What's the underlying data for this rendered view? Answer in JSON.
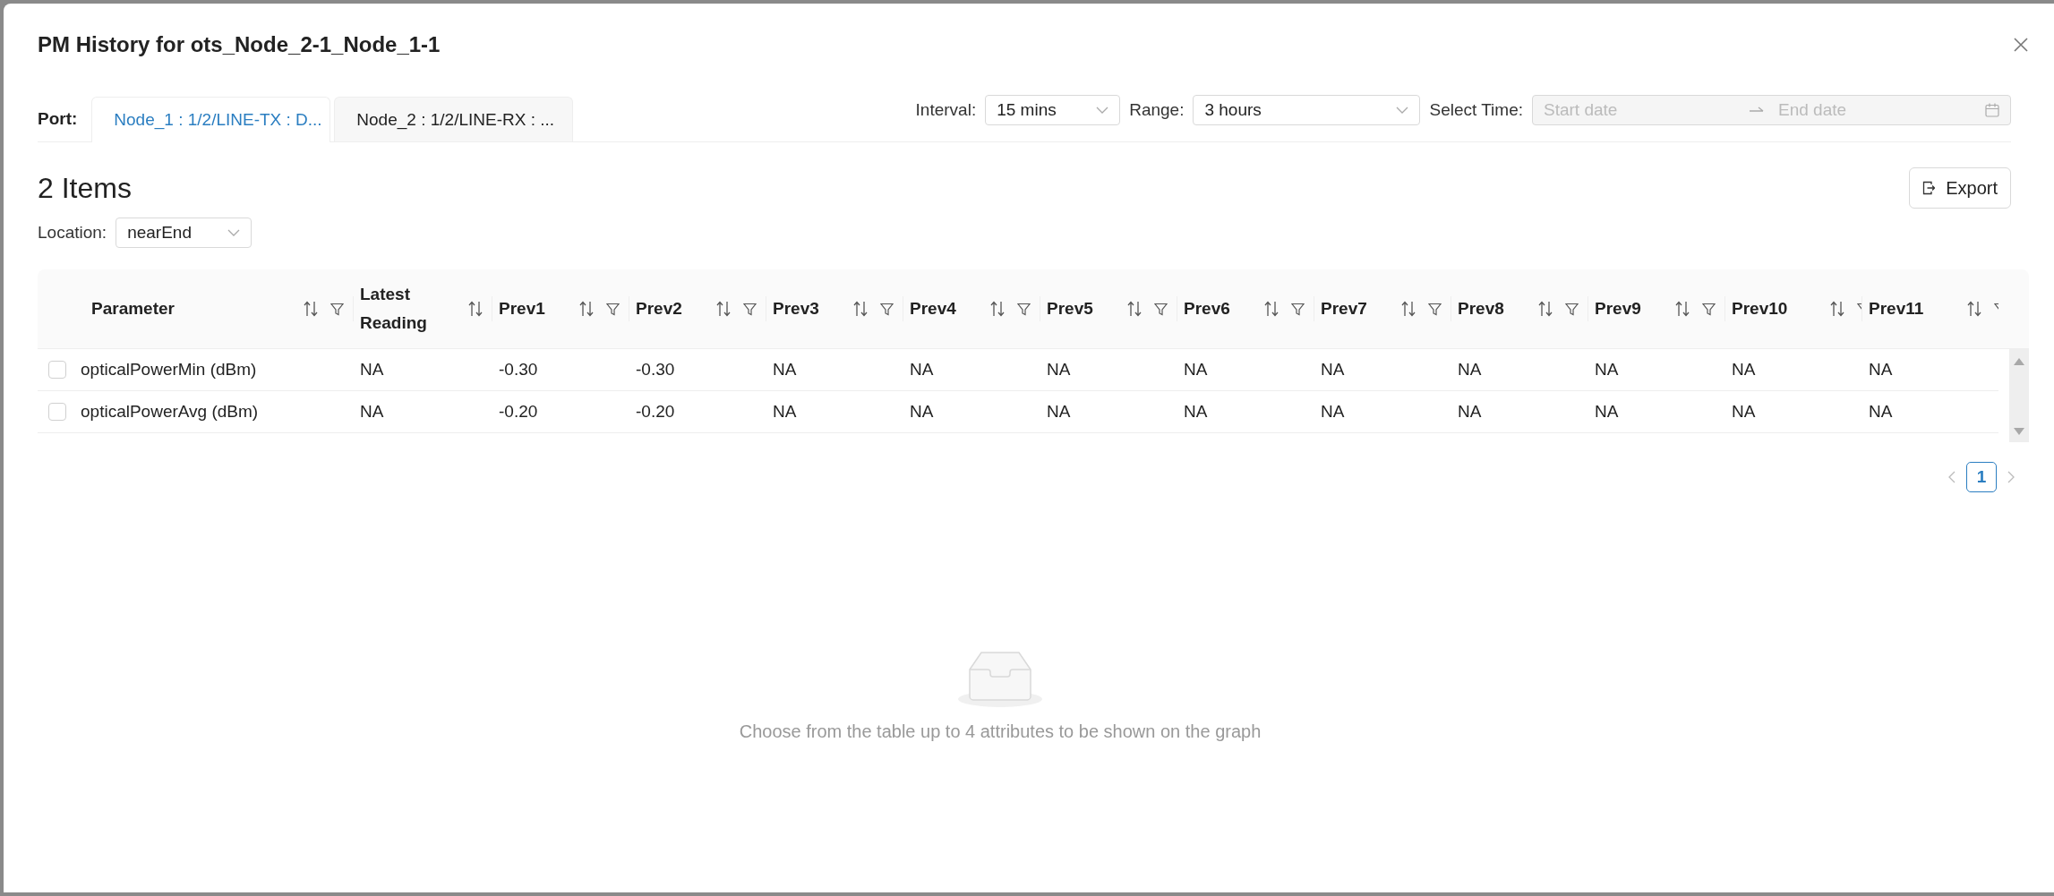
{
  "dialog": {
    "title": "PM History for ots_Node_2-1_Node_1-1"
  },
  "port": {
    "label": "Port:",
    "tabs": [
      {
        "label": "Node_1 : 1/2/LINE-TX : D...",
        "selected": true
      },
      {
        "label": "Node_2 : 1/2/LINE-RX : ...",
        "selected": false
      }
    ]
  },
  "interval": {
    "label": "Interval:",
    "value": "15 mins"
  },
  "range": {
    "label": "Range:",
    "value": "3 hours"
  },
  "select_time": {
    "label": "Select Time:",
    "start_placeholder": "Start date",
    "end_placeholder": "End date",
    "disabled": true
  },
  "items_count": "2 Items",
  "export_button": "Export",
  "location": {
    "label": "Location:",
    "value": "nearEnd"
  },
  "table": {
    "columns": [
      {
        "label": "Parameter",
        "sortable": true,
        "filterable": true
      },
      {
        "label": "Latest Reading",
        "sortable": true,
        "filterable": false
      },
      {
        "label": "Prev1",
        "sortable": true,
        "filterable": true
      },
      {
        "label": "Prev2",
        "sortable": true,
        "filterable": true
      },
      {
        "label": "Prev3",
        "sortable": true,
        "filterable": true
      },
      {
        "label": "Prev4",
        "sortable": true,
        "filterable": true
      },
      {
        "label": "Prev5",
        "sortable": true,
        "filterable": true
      },
      {
        "label": "Prev6",
        "sortable": true,
        "filterable": true
      },
      {
        "label": "Prev7",
        "sortable": true,
        "filterable": true
      },
      {
        "label": "Prev8",
        "sortable": true,
        "filterable": true
      },
      {
        "label": "Prev9",
        "sortable": true,
        "filterable": true
      },
      {
        "label": "Prev10",
        "sortable": true,
        "filterable": true
      },
      {
        "label": "Prev11",
        "sortable": true,
        "filterable": true
      }
    ],
    "rows": [
      {
        "checked": false,
        "cells": [
          "opticalPowerMin (dBm)",
          "NA",
          "-0.30",
          "-0.30",
          "NA",
          "NA",
          "NA",
          "NA",
          "NA",
          "NA",
          "NA",
          "NA",
          "NA"
        ]
      },
      {
        "checked": false,
        "cells": [
          "opticalPowerAvg (dBm)",
          "NA",
          "-0.20",
          "-0.20",
          "NA",
          "NA",
          "NA",
          "NA",
          "NA",
          "NA",
          "NA",
          "NA",
          "NA"
        ]
      }
    ]
  },
  "pagination": {
    "pages": [
      {
        "label": "1",
        "selected": true
      }
    ]
  },
  "empty_state": {
    "message": "Choose from the table up to 4 attributes to be shown on the graph"
  }
}
